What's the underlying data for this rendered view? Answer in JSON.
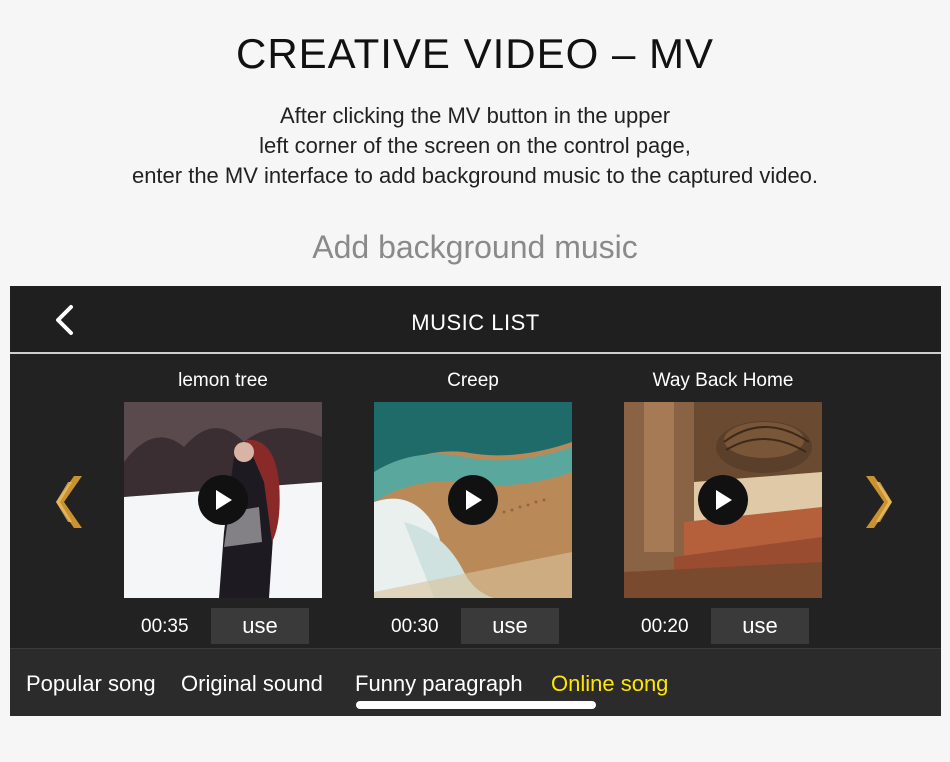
{
  "page": {
    "headline": "CREATIVE VIDEO – MV",
    "description": [
      "After clicking the MV button in the upper",
      "left corner of the screen on the control page,",
      "enter the MV interface to add background music to the captured video."
    ],
    "subheading": "Add background music"
  },
  "app": {
    "header": {
      "title": "MUSIC LIST",
      "back_icon": "chevron-left-icon"
    },
    "carousel": {
      "prev_icon": "double-chevron-left-icon",
      "next_icon": "double-chevron-right-icon",
      "accent_color": "#c9922e"
    },
    "songs": [
      {
        "title": "lemon tree",
        "duration": "00:35",
        "use_label": "use"
      },
      {
        "title": "Creep",
        "duration": "00:30",
        "use_label": "use"
      },
      {
        "title": "Way Back Home",
        "duration": "00:20",
        "use_label": "use"
      }
    ],
    "tabs": [
      {
        "label": "Popular song",
        "active": false
      },
      {
        "label": "Original sound",
        "active": false
      },
      {
        "label": "Funny paragraph",
        "active": false
      },
      {
        "label": "Online song",
        "active": true
      }
    ],
    "active_tab_color": "#ffe600"
  }
}
